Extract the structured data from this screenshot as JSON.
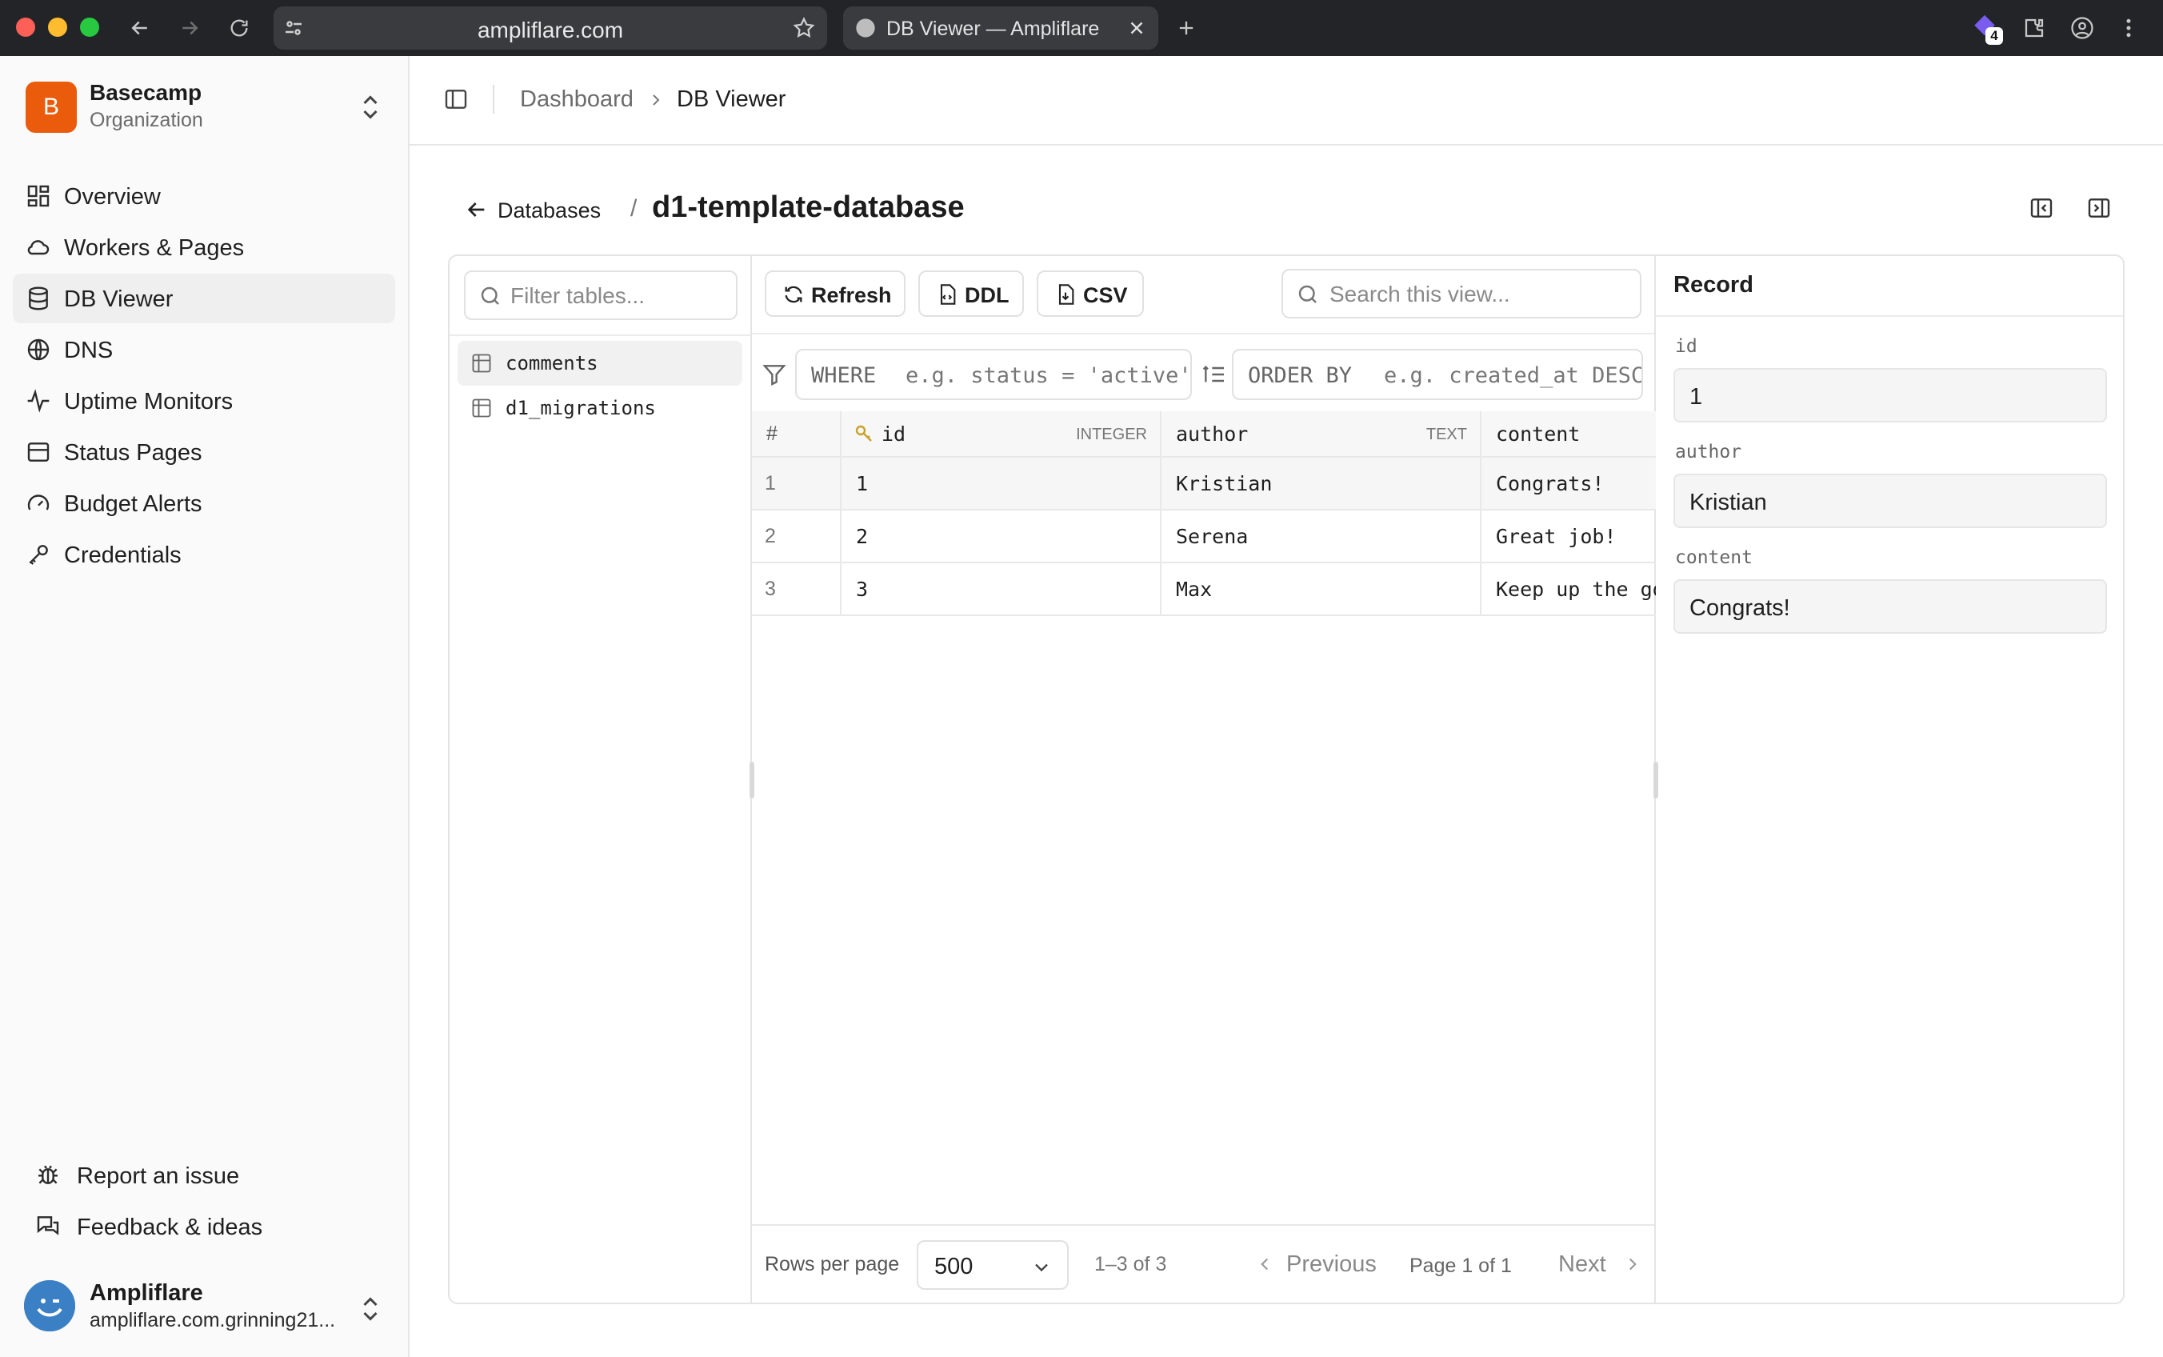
{
  "browser": {
    "url": "ampliflare.com",
    "tab_title": "DB Viewer — Ampliflare",
    "extension_badge": "4"
  },
  "org": {
    "initial": "B",
    "name": "Basecamp",
    "subtitle": "Organization"
  },
  "sidebar": {
    "items": [
      {
        "label": "Overview",
        "icon": "overview-icon"
      },
      {
        "label": "Workers & Pages",
        "icon": "cloud-icon"
      },
      {
        "label": "DB Viewer",
        "icon": "database-icon",
        "active": true
      },
      {
        "label": "DNS",
        "icon": "globe-icon"
      },
      {
        "label": "Uptime Monitors",
        "icon": "activity-icon"
      },
      {
        "label": "Status Pages",
        "icon": "status-page-icon"
      },
      {
        "label": "Budget Alerts",
        "icon": "gauge-icon"
      },
      {
        "label": "Credentials",
        "icon": "key-icon"
      }
    ],
    "footer": {
      "report": "Report an issue",
      "feedback": "Feedback & ideas"
    },
    "user": {
      "name": "Ampliflare",
      "email": "ampliflare.com.grinning21..."
    }
  },
  "header": {
    "breadcrumb_root": "Dashboard",
    "breadcrumb_current": "DB Viewer"
  },
  "page": {
    "back_label": "Databases",
    "separator": "/",
    "database_name": "d1-template-database"
  },
  "tables": {
    "filter_placeholder": "Filter tables...",
    "items": [
      "comments",
      "d1_migrations"
    ],
    "selected": "comments"
  },
  "toolbar": {
    "refresh": "Refresh",
    "ddl": "DDL",
    "csv": "CSV",
    "search_placeholder": "Search this view..."
  },
  "query": {
    "where_keyword": "WHERE",
    "where_placeholder": "e.g. status = 'active'",
    "order_keyword": "ORDER BY",
    "order_placeholder": "e.g. created_at DESC"
  },
  "grid": {
    "columns": [
      {
        "name": "#",
        "type": ""
      },
      {
        "name": "id",
        "type": "INTEGER",
        "primary_key": true
      },
      {
        "name": "author",
        "type": "TEXT"
      },
      {
        "name": "content",
        "type": ""
      }
    ],
    "rows": [
      {
        "n": "1",
        "id": "1",
        "author": "Kristian",
        "content": "Congrats!"
      },
      {
        "n": "2",
        "id": "2",
        "author": "Serena",
        "content": "Great job!"
      },
      {
        "n": "3",
        "id": "3",
        "author": "Max",
        "content": "Keep up the good work!"
      }
    ],
    "selected_row": 0
  },
  "pagination": {
    "rows_per_page_label": "Rows per page",
    "rows_per_page_value": "500",
    "range": "1–3 of 3",
    "previous": "Previous",
    "page": "Page 1 of 1",
    "next": "Next"
  },
  "record": {
    "title": "Record",
    "fields": [
      {
        "label": "id",
        "value": "1"
      },
      {
        "label": "author",
        "value": "Kristian"
      },
      {
        "label": "content",
        "value": "Congrats!"
      }
    ]
  },
  "colors": {
    "org_avatar": "#ea5b0c",
    "chrome_bg": "#232427",
    "traffic_red": "#fe5f57",
    "traffic_yellow": "#febc2e",
    "traffic_green": "#28c840"
  }
}
